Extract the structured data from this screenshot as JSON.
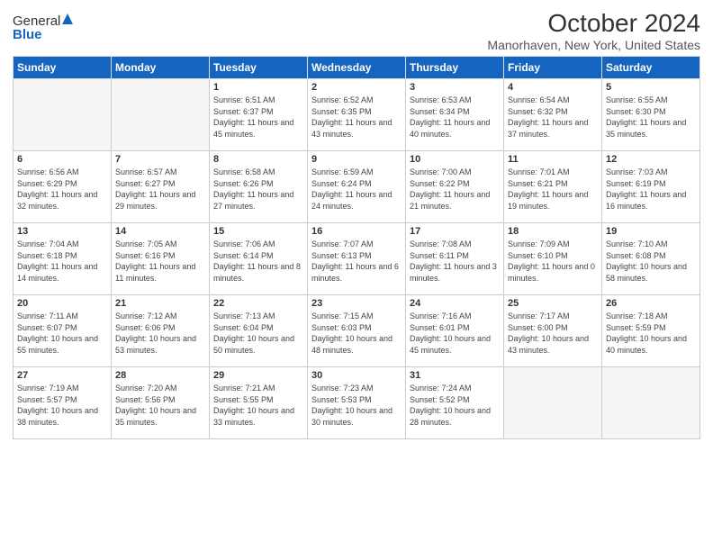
{
  "header": {
    "logo_general": "General",
    "logo_blue": "Blue",
    "month": "October 2024",
    "location": "Manorhaven, New York, United States"
  },
  "days_of_week": [
    "Sunday",
    "Monday",
    "Tuesday",
    "Wednesday",
    "Thursday",
    "Friday",
    "Saturday"
  ],
  "weeks": [
    [
      {
        "num": "",
        "info": ""
      },
      {
        "num": "",
        "info": ""
      },
      {
        "num": "1",
        "info": "Sunrise: 6:51 AM\nSunset: 6:37 PM\nDaylight: 11 hours and 45 minutes."
      },
      {
        "num": "2",
        "info": "Sunrise: 6:52 AM\nSunset: 6:35 PM\nDaylight: 11 hours and 43 minutes."
      },
      {
        "num": "3",
        "info": "Sunrise: 6:53 AM\nSunset: 6:34 PM\nDaylight: 11 hours and 40 minutes."
      },
      {
        "num": "4",
        "info": "Sunrise: 6:54 AM\nSunset: 6:32 PM\nDaylight: 11 hours and 37 minutes."
      },
      {
        "num": "5",
        "info": "Sunrise: 6:55 AM\nSunset: 6:30 PM\nDaylight: 11 hours and 35 minutes."
      }
    ],
    [
      {
        "num": "6",
        "info": "Sunrise: 6:56 AM\nSunset: 6:29 PM\nDaylight: 11 hours and 32 minutes."
      },
      {
        "num": "7",
        "info": "Sunrise: 6:57 AM\nSunset: 6:27 PM\nDaylight: 11 hours and 29 minutes."
      },
      {
        "num": "8",
        "info": "Sunrise: 6:58 AM\nSunset: 6:26 PM\nDaylight: 11 hours and 27 minutes."
      },
      {
        "num": "9",
        "info": "Sunrise: 6:59 AM\nSunset: 6:24 PM\nDaylight: 11 hours and 24 minutes."
      },
      {
        "num": "10",
        "info": "Sunrise: 7:00 AM\nSunset: 6:22 PM\nDaylight: 11 hours and 21 minutes."
      },
      {
        "num": "11",
        "info": "Sunrise: 7:01 AM\nSunset: 6:21 PM\nDaylight: 11 hours and 19 minutes."
      },
      {
        "num": "12",
        "info": "Sunrise: 7:03 AM\nSunset: 6:19 PM\nDaylight: 11 hours and 16 minutes."
      }
    ],
    [
      {
        "num": "13",
        "info": "Sunrise: 7:04 AM\nSunset: 6:18 PM\nDaylight: 11 hours and 14 minutes."
      },
      {
        "num": "14",
        "info": "Sunrise: 7:05 AM\nSunset: 6:16 PM\nDaylight: 11 hours and 11 minutes."
      },
      {
        "num": "15",
        "info": "Sunrise: 7:06 AM\nSunset: 6:14 PM\nDaylight: 11 hours and 8 minutes."
      },
      {
        "num": "16",
        "info": "Sunrise: 7:07 AM\nSunset: 6:13 PM\nDaylight: 11 hours and 6 minutes."
      },
      {
        "num": "17",
        "info": "Sunrise: 7:08 AM\nSunset: 6:11 PM\nDaylight: 11 hours and 3 minutes."
      },
      {
        "num": "18",
        "info": "Sunrise: 7:09 AM\nSunset: 6:10 PM\nDaylight: 11 hours and 0 minutes."
      },
      {
        "num": "19",
        "info": "Sunrise: 7:10 AM\nSunset: 6:08 PM\nDaylight: 10 hours and 58 minutes."
      }
    ],
    [
      {
        "num": "20",
        "info": "Sunrise: 7:11 AM\nSunset: 6:07 PM\nDaylight: 10 hours and 55 minutes."
      },
      {
        "num": "21",
        "info": "Sunrise: 7:12 AM\nSunset: 6:06 PM\nDaylight: 10 hours and 53 minutes."
      },
      {
        "num": "22",
        "info": "Sunrise: 7:13 AM\nSunset: 6:04 PM\nDaylight: 10 hours and 50 minutes."
      },
      {
        "num": "23",
        "info": "Sunrise: 7:15 AM\nSunset: 6:03 PM\nDaylight: 10 hours and 48 minutes."
      },
      {
        "num": "24",
        "info": "Sunrise: 7:16 AM\nSunset: 6:01 PM\nDaylight: 10 hours and 45 minutes."
      },
      {
        "num": "25",
        "info": "Sunrise: 7:17 AM\nSunset: 6:00 PM\nDaylight: 10 hours and 43 minutes."
      },
      {
        "num": "26",
        "info": "Sunrise: 7:18 AM\nSunset: 5:59 PM\nDaylight: 10 hours and 40 minutes."
      }
    ],
    [
      {
        "num": "27",
        "info": "Sunrise: 7:19 AM\nSunset: 5:57 PM\nDaylight: 10 hours and 38 minutes."
      },
      {
        "num": "28",
        "info": "Sunrise: 7:20 AM\nSunset: 5:56 PM\nDaylight: 10 hours and 35 minutes."
      },
      {
        "num": "29",
        "info": "Sunrise: 7:21 AM\nSunset: 5:55 PM\nDaylight: 10 hours and 33 minutes."
      },
      {
        "num": "30",
        "info": "Sunrise: 7:23 AM\nSunset: 5:53 PM\nDaylight: 10 hours and 30 minutes."
      },
      {
        "num": "31",
        "info": "Sunrise: 7:24 AM\nSunset: 5:52 PM\nDaylight: 10 hours and 28 minutes."
      },
      {
        "num": "",
        "info": ""
      },
      {
        "num": "",
        "info": ""
      }
    ]
  ]
}
